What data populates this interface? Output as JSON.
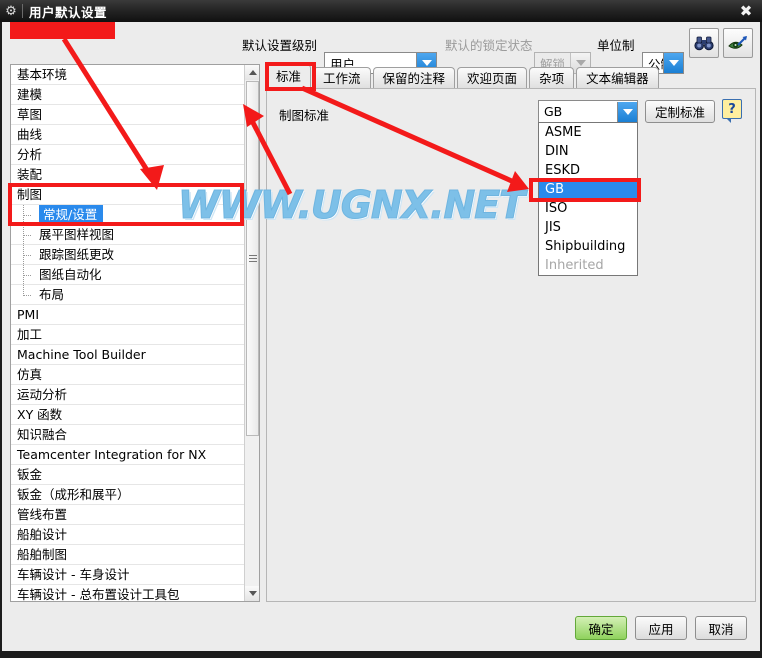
{
  "window": {
    "title": "用户默认设置",
    "gear_icon": "gear-icon",
    "close_label": "✖"
  },
  "toolbar": {
    "level_label": "默认设置级别",
    "level_value": "用户",
    "lock_label": "默认的锁定状态",
    "lock_value": "解锁",
    "units_label": "单位制",
    "units_value": "公制",
    "find_icon": "binoculars-icon",
    "view_icon": "eye-arrow-icon"
  },
  "tree": {
    "items": [
      {
        "label": "基本环境",
        "level": 0,
        "selected": false
      },
      {
        "label": "建模",
        "level": 0,
        "selected": false
      },
      {
        "label": "草图",
        "level": 0,
        "selected": false
      },
      {
        "label": "曲线",
        "level": 0,
        "selected": false
      },
      {
        "label": "分析",
        "level": 0,
        "selected": false
      },
      {
        "label": "装配",
        "level": 0,
        "selected": false
      },
      {
        "label": "制图",
        "level": 0,
        "selected": false
      },
      {
        "label": "常规/设置",
        "level": 1,
        "selected": true
      },
      {
        "label": "展平图样视图",
        "level": 1,
        "selected": false
      },
      {
        "label": "跟踪图纸更改",
        "level": 1,
        "selected": false
      },
      {
        "label": "图纸自动化",
        "level": 1,
        "selected": false
      },
      {
        "label": "布局",
        "level": 1,
        "selected": false,
        "last": true
      },
      {
        "label": "PMI",
        "level": 0,
        "selected": false
      },
      {
        "label": "加工",
        "level": 0,
        "selected": false
      },
      {
        "label": "Machine Tool Builder",
        "level": 0,
        "selected": false
      },
      {
        "label": "仿真",
        "level": 0,
        "selected": false
      },
      {
        "label": "运动分析",
        "level": 0,
        "selected": false
      },
      {
        "label": "XY 函数",
        "level": 0,
        "selected": false
      },
      {
        "label": "知识融合",
        "level": 0,
        "selected": false
      },
      {
        "label": "Teamcenter Integration for NX",
        "level": 0,
        "selected": false
      },
      {
        "label": "钣金",
        "level": 0,
        "selected": false
      },
      {
        "label": "钣金（成形和展平）",
        "level": 0,
        "selected": false
      },
      {
        "label": "管线布置",
        "level": 0,
        "selected": false
      },
      {
        "label": "船舶设计",
        "level": 0,
        "selected": false
      },
      {
        "label": "船舶制图",
        "level": 0,
        "selected": false
      },
      {
        "label": "车辆设计 - 车身设计",
        "level": 0,
        "selected": false
      },
      {
        "label": "车辆设计 - 总布置设计工具包",
        "level": 0,
        "selected": false
      }
    ]
  },
  "tabs": [
    {
      "label": "标准",
      "active": true
    },
    {
      "label": "工作流",
      "active": false
    },
    {
      "label": "保留的注释",
      "active": false
    },
    {
      "label": "欢迎页面",
      "active": false
    },
    {
      "label": "杂项",
      "active": false
    },
    {
      "label": "文本编辑器",
      "active": false
    }
  ],
  "panel": {
    "standard_label": "制图标准",
    "standard_value": "GB",
    "custom_button": "定制标准",
    "help_glyph": "?",
    "dropdown_options": [
      {
        "label": "ASME",
        "selected": false,
        "disabled": false
      },
      {
        "label": "DIN",
        "selected": false,
        "disabled": false
      },
      {
        "label": "ESKD",
        "selected": false,
        "disabled": false
      },
      {
        "label": "GB",
        "selected": true,
        "disabled": false
      },
      {
        "label": "ISO",
        "selected": false,
        "disabled": false
      },
      {
        "label": "JIS",
        "selected": false,
        "disabled": false
      },
      {
        "label": "Shipbuilding",
        "selected": false,
        "disabled": false
      },
      {
        "label": "Inherited",
        "selected": false,
        "disabled": true
      }
    ]
  },
  "buttons": {
    "ok": "确定",
    "apply": "应用",
    "cancel": "取消"
  },
  "watermark": {
    "text": "WWW.UGNX.NET"
  },
  "colors": {
    "accent": "#2a8aec",
    "annotation": "#f31a1a",
    "ok_green": "#8fd25d",
    "titlebar": "#1c1c1c"
  }
}
